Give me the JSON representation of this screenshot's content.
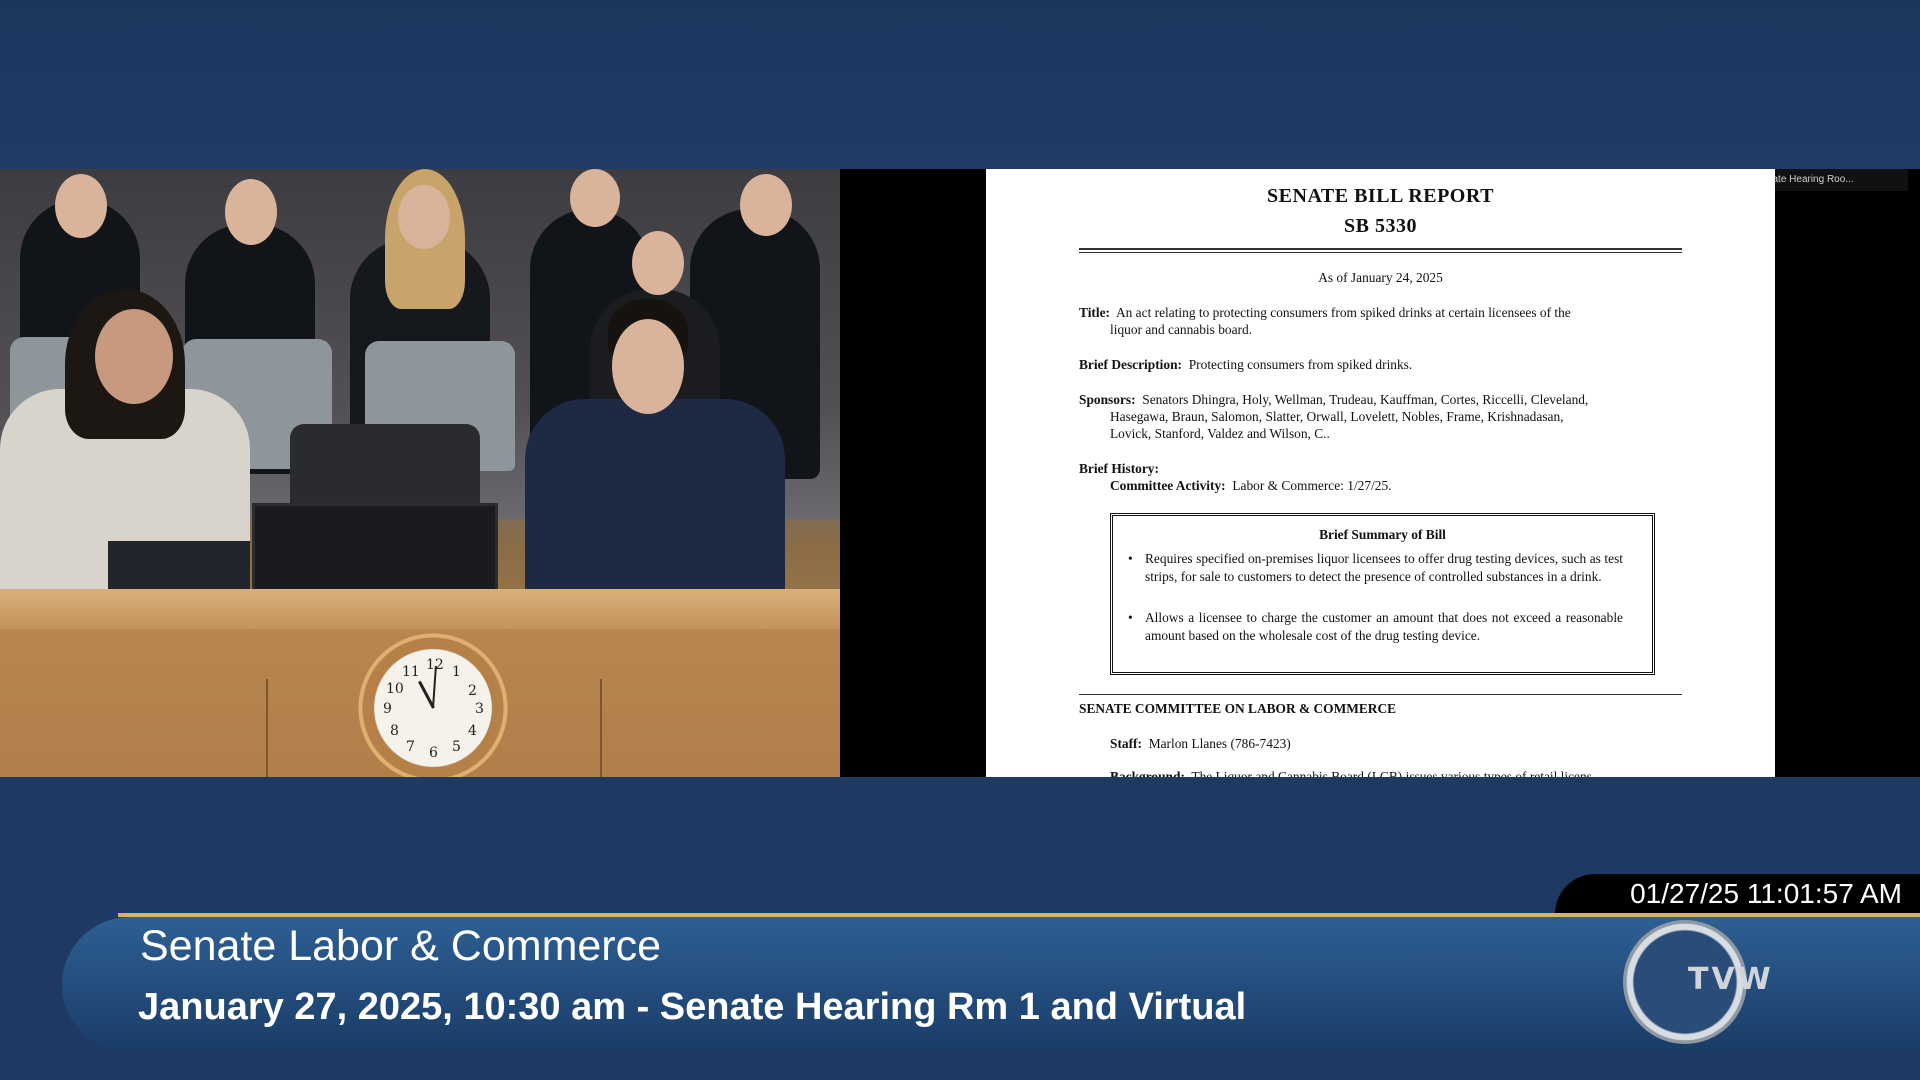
{
  "share": {
    "talking_label": "Talking: Senate Hearing Roo...",
    "report_title": "SENATE BILL REPORT",
    "bill_number": "SB 5330",
    "as_of": "As of January 24, 2025",
    "title_label": "Title:",
    "title_text_1": "An act relating to protecting consumers from spiked drinks at certain licensees of the",
    "title_text_2": "liquor and cannabis board.",
    "brief_description_label": "Brief Description:",
    "brief_description_text": "Protecting consumers from spiked drinks.",
    "sponsors_label": "Sponsors:",
    "sponsors_text_1": "Senators Dhingra, Holy, Wellman, Trudeau, Kauffman, Cortes, Riccelli, Cleveland,",
    "sponsors_text_2": "Hasegawa, Braun, Salomon, Slatter, Orwall, Lovelett, Nobles, Frame, Krishnadasan,",
    "sponsors_text_3": "Lovick, Stanford, Valdez and Wilson, C..",
    "brief_history_label": "Brief History:",
    "committee_activity_label": "Committee Activity:",
    "committee_activity_text": "Labor & Commerce: 1/27/25.",
    "summary_title": "Brief Summary of Bill",
    "bullet_1": "Requires specified on-premises liquor licensees to offer drug testing devices, such as test strips, for sale to customers to detect the presence of controlled substances in a drink.",
    "bullet_2": "Allows a licensee to charge the customer an amount that does not exceed a reasonable amount based on the wholesale cost of the drug testing device.",
    "committee_section": "SENATE COMMITTEE ON LABOR & COMMERCE",
    "staff_label": "Staff:",
    "staff_text": "Marlon Llanes (786-7423)",
    "background_label": "Background:",
    "background_text": "The Liquor and Cannabis Board (LCB) issues various types of retail licens"
  },
  "overlay": {
    "timestamp": "01/27/25 11:01:57 AM",
    "committee_name": "Senate Labor & Commerce",
    "session_info": "January 27, 2025, 10:30 am - Senate Hearing Rm 1 and Virtual",
    "logo_text": "TVW"
  },
  "clock": {
    "numerals": [
      "12",
      "1",
      "2",
      "3",
      "4",
      "5",
      "6",
      "7",
      "8",
      "9",
      "10",
      "11"
    ]
  }
}
